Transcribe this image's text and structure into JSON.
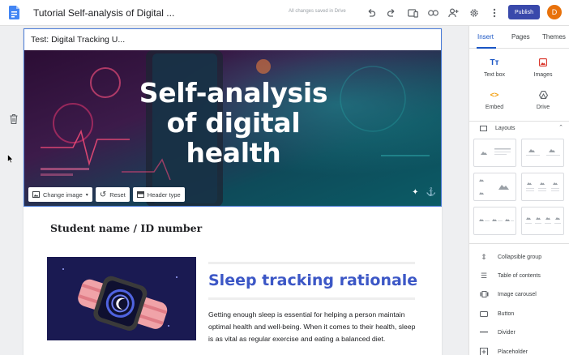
{
  "header": {
    "doc_title": "Tutorial Self-analysis of Digital ...",
    "save_status": "All changes saved in Drive",
    "publish_label": "Publish",
    "avatar_initial": "D",
    "icons": [
      "undo-icon",
      "redo-icon",
      "preview-icon",
      "link-icon",
      "share-icon",
      "settings-icon",
      "more-vert-icon"
    ]
  },
  "site": {
    "site_title": "Test: Digital Tracking U...",
    "banner_title_lines": [
      "Self-analysis",
      "of digital",
      "health"
    ],
    "banner_tools": {
      "change_image": "Change image",
      "reset": "Reset",
      "header_type": "Header type"
    },
    "student_heading": "Student name / ID number",
    "section_title": "Sleep tracking rationale",
    "paragraph": "Getting enough sleep is essential for helping a person maintain optimal health and well-being. When it comes to their health, sleep is as vital as regular exercise and eating a balanced diet."
  },
  "panel": {
    "tabs": [
      {
        "label": "Insert",
        "active": true
      },
      {
        "label": "Pages",
        "active": false
      },
      {
        "label": "Themes",
        "active": false
      }
    ],
    "insert_items": [
      {
        "label": "Text box",
        "icon": "text-box-icon"
      },
      {
        "label": "Images",
        "icon": "image-icon"
      },
      {
        "label": "Embed",
        "icon": "embed-icon"
      },
      {
        "label": "Drive",
        "icon": "drive-icon"
      }
    ],
    "layouts_label": "Layouts",
    "components": [
      {
        "label": "Collapsible group",
        "icon": "collapsible-group-icon"
      },
      {
        "label": "Table of contents",
        "icon": "table-of-contents-icon"
      },
      {
        "label": "Image carousel",
        "icon": "image-carousel-icon"
      },
      {
        "label": "Button",
        "icon": "button-icon"
      },
      {
        "label": "Divider",
        "icon": "divider-icon"
      },
      {
        "label": "Placeholder",
        "icon": "placeholder-icon"
      }
    ]
  },
  "colors": {
    "accent": "#1a55c4",
    "publish": "#3949ab",
    "heading": "#3c57c6",
    "avatar": "#e8710a"
  }
}
